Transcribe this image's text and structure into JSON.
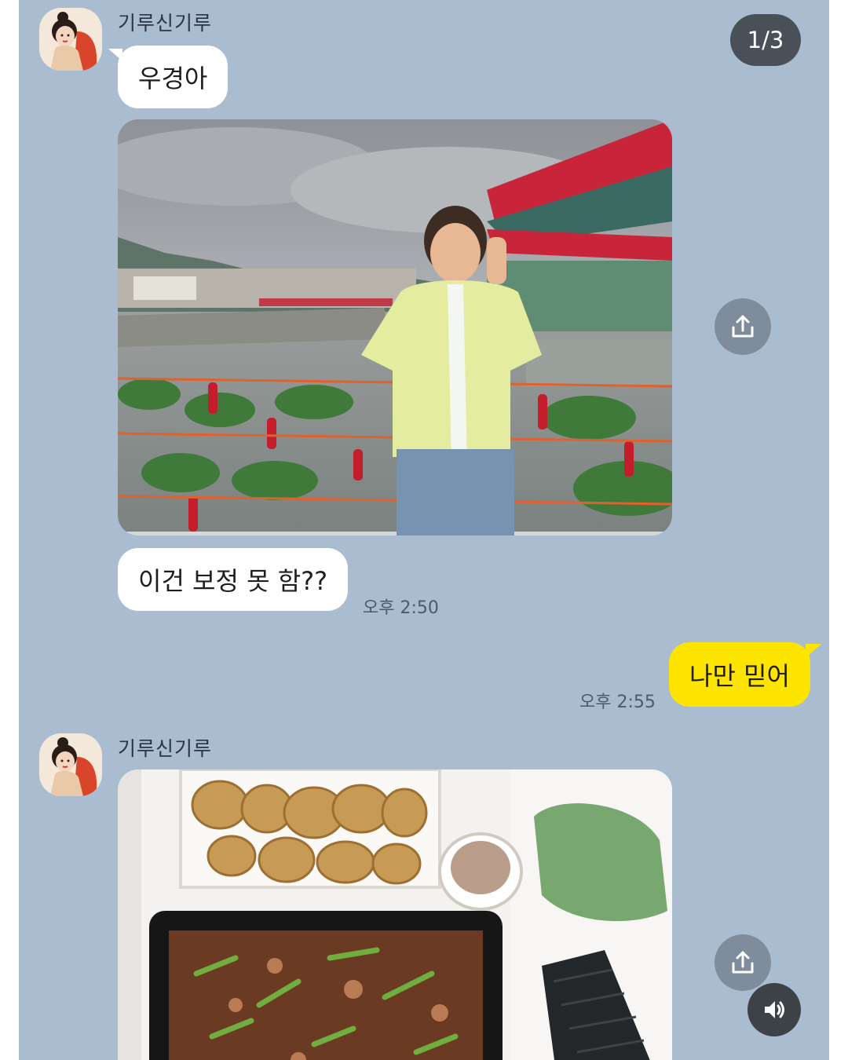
{
  "page_indicator": "1/3",
  "messages": {
    "first_group": {
      "sender": "기루신기루",
      "text1": "우경아",
      "text2": "이건 보정 못 함??",
      "time": "오후 2:50"
    },
    "my_message": {
      "text": "나만 믿어",
      "time": "오후 2:55"
    },
    "second_group": {
      "sender": "기루신기루"
    }
  },
  "icons": {
    "share": "share-icon",
    "sound": "speaker-icon",
    "avatar": "avatar-illustration"
  },
  "colors": {
    "chat_background": "#aabdd0",
    "my_bubble": "#fee500",
    "other_bubble": "#ffffff"
  }
}
